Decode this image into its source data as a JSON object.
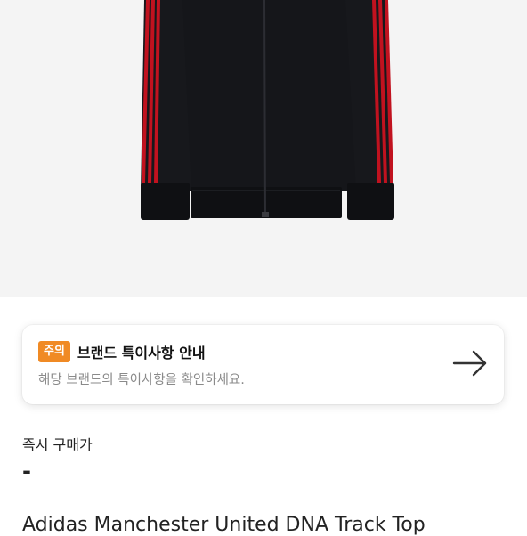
{
  "product": {
    "image_icon": "track-jacket-photo",
    "name": "Adidas Manchester United DNA Track Top"
  },
  "notice": {
    "badge": "주의",
    "title": "브랜드 특이사항 안내",
    "description": "해당 브랜드의 특이사항을 확인하세요.",
    "arrow_icon": "arrow-right-icon",
    "badge_color": "#f08a24"
  },
  "price": {
    "label": "즉시 구매가",
    "value": "-"
  }
}
